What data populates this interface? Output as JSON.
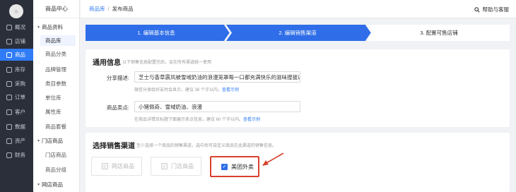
{
  "nav": {
    "logo_alt": "logo",
    "items": [
      {
        "label": "概况",
        "icon": "monitor-icon"
      },
      {
        "label": "店铺",
        "icon": "store-icon"
      },
      {
        "label": "商品",
        "icon": "goods-icon",
        "active": true
      },
      {
        "label": "库存",
        "icon": "inventory-icon"
      },
      {
        "label": "采购",
        "icon": "purchase-icon"
      },
      {
        "label": "订单",
        "icon": "order-icon"
      },
      {
        "label": "客户",
        "icon": "customer-icon"
      },
      {
        "label": "数据",
        "icon": "data-icon"
      },
      {
        "label": "资产",
        "icon": "asset-icon"
      },
      {
        "label": "财务",
        "icon": "finance-icon"
      }
    ]
  },
  "sub": {
    "title": "商品中心",
    "group1": "商品资料",
    "items1": [
      "商品库",
      "商品分类",
      "品牌管理",
      "类目参数",
      "单位库",
      "属性库",
      "商品套餐"
    ],
    "group2": "门店商品",
    "items2": [
      "门店商品",
      "商品分组"
    ],
    "group3": "网店商品"
  },
  "topbar": {
    "crumb_parent": "商品库",
    "crumb_sep": "/",
    "crumb_current": "发布商品",
    "help": "帮助与客服"
  },
  "steps": [
    "1. 编辑基本信息",
    "2. 编辑销售渠道",
    "3. 配置可售店铺"
  ],
  "general": {
    "title": "通用信息",
    "hint": "以下销售信息配置完后，会在所有渠道统一使用",
    "share_label": "分享描述:",
    "share_value": "芝士与香草震风被雪域奶油的浪漫笼罩每一口都充满快乐的滋味搜拔近",
    "share_tip": "微信分享给好友时会显示，建议 36 个字以内。",
    "share_link": "查看示例",
    "selling_label": "商品卖点:",
    "selling_value": "小猪佩奇、雪域奶油、浪漫",
    "selling_tip": "在商品详情页标题下面展示卖点信息，建议 60 个字以内。",
    "selling_link": "查看示例"
  },
  "channels": {
    "title": "选择销售渠道",
    "hint": "至少选择一个商品的销售渠道，选中后可自定义商品在此渠道的销售信息。",
    "options": [
      {
        "label": "网店商品",
        "checked": true,
        "disabled": true
      },
      {
        "label": "门店商品",
        "checked": true,
        "disabled": true
      },
      {
        "label": "美团外卖",
        "checked": true,
        "disabled": false
      }
    ]
  },
  "colors": {
    "primary": "#2f6ee8",
    "highlight": "#d9412e",
    "sidebar": "#2b2f3a"
  }
}
